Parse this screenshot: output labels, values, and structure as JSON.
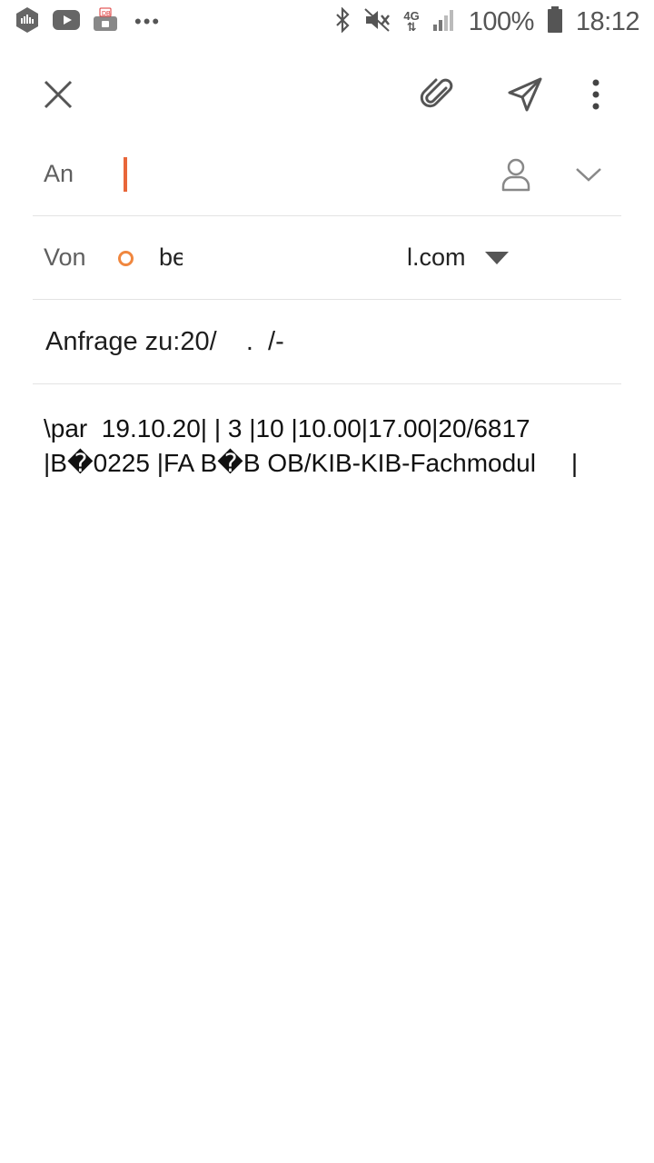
{
  "status_bar": {
    "battery": "100%",
    "time": "18:12",
    "network": "4G",
    "left_icons": [
      "soundcloud-icon",
      "youtube-icon",
      "db-navigator-icon",
      "more-notifications-icon"
    ],
    "right_icons": [
      "bluetooth-icon",
      "mute-icon",
      "signal-icon",
      "battery-icon"
    ]
  },
  "toolbar": {
    "icons": [
      "close-icon",
      "paperclip-icon",
      "send-icon",
      "more-vert-icon"
    ]
  },
  "compose": {
    "to_label": "An",
    "from_label": "Von",
    "from_part1": "be",
    "from_part2": "l.com",
    "subject": "Anfrage zu:20/    .  /-",
    "body": "\\par  19.10.20| | 3 |10 |10.00|17.00|20/6817   |B�0225 |FA B�B OB/KIB-KIB-Fachmodul     |"
  },
  "colors": {
    "accent": "#e8663a",
    "account_dot": "#f0873f",
    "icon_gray": "#555555",
    "divider": "#e3e3e3"
  }
}
